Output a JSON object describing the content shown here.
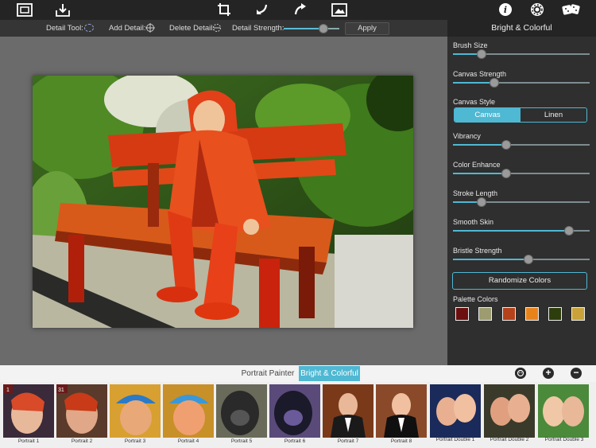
{
  "toolbar": {
    "icons": [
      "gallery-icon",
      "save-icon",
      "crop-icon",
      "undo-icon",
      "redo-icon",
      "image-icon",
      "info-icon",
      "settings-icon",
      "randomize-dice-icon"
    ]
  },
  "detail_bar": {
    "detail_tool_label": "Detail Tool:",
    "add_detail_label": "Add Detail:",
    "delete_detail_label": "Delete Detail:",
    "strength_label": "Detail Strength:",
    "strength_value": 0.72,
    "apply_label": "Apply"
  },
  "panel": {
    "title": "Bright & Colorful",
    "brush_size": {
      "label": "Brush Size",
      "value": 0.21
    },
    "canvas_strength": {
      "label": "Canvas Strength",
      "value": 0.3
    },
    "canvas_style": {
      "label": "Canvas Style",
      "options": [
        "Canvas",
        "Linen"
      ],
      "selected": "Canvas"
    },
    "vibrancy": {
      "label": "Vibrancy",
      "value": 0.39
    },
    "color_enhance": {
      "label": "Color Enhance",
      "value": 0.39
    },
    "stroke_length": {
      "label": "Stroke Length",
      "value": 0.21
    },
    "smooth_skin": {
      "label": "Smooth Skin",
      "value": 0.85
    },
    "bristle_strength": {
      "label": "Bristle Strength",
      "value": 0.55
    },
    "randomize_label": "Randomize Colors",
    "palette_label": "Palette Colors",
    "palette": [
      "#6b0f0f",
      "#9c9c70",
      "#b4421a",
      "#e8831c",
      "#2e3d0c",
      "#c9a23a"
    ]
  },
  "tabs": [
    "Portrait Painter",
    "Bright & Colorful"
  ],
  "tab_selected": "Bright & Colorful",
  "thumbnails": [
    "Portrait 1",
    "Portrait 2",
    "Portrait 3",
    "Portrait 4",
    "Portrait 5",
    "Portrait 6",
    "Portrait 7",
    "Portrait 8",
    "Portrait Double 1",
    "Portrait Double 2",
    "Portrait Double 3"
  ],
  "thumb_badges": {
    "first": "1",
    "second": "31"
  },
  "accent": "#4fb8d3"
}
